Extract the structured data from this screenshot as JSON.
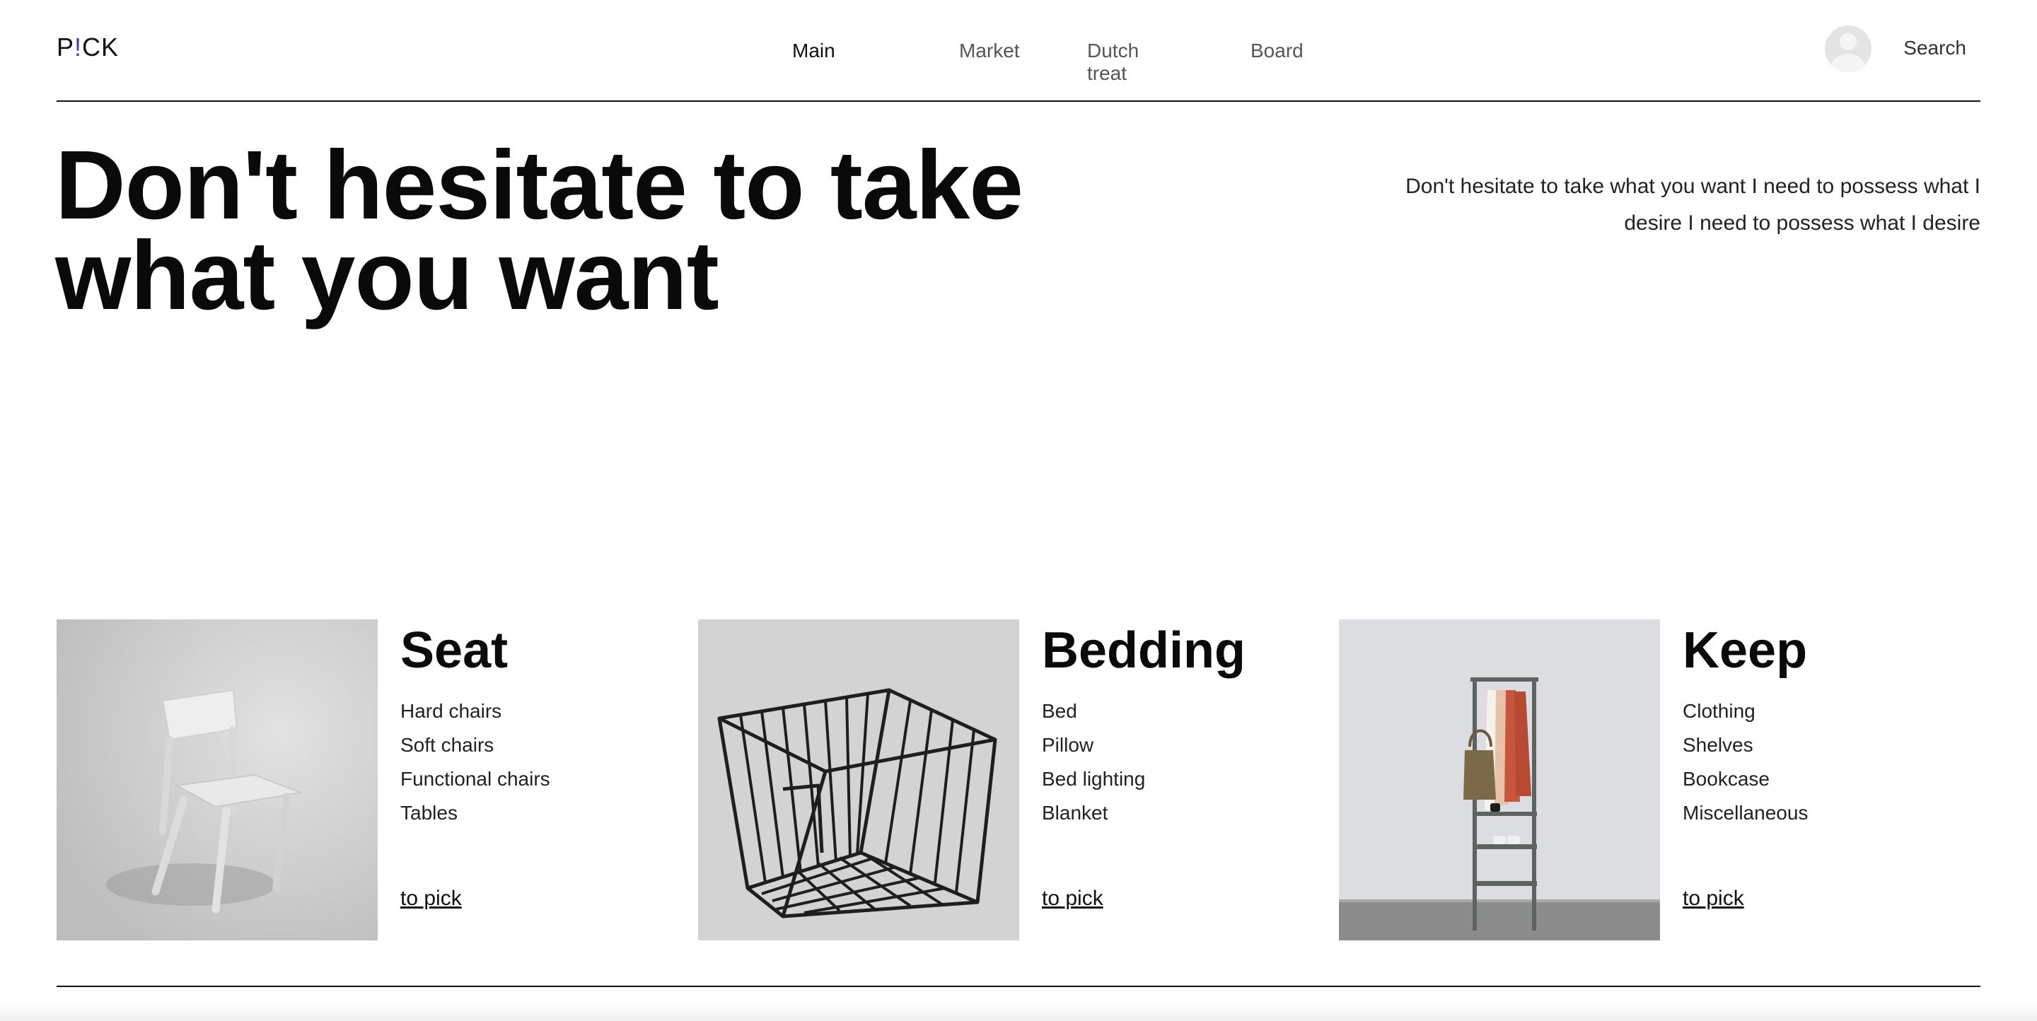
{
  "header": {
    "logo_left": "P",
    "logo_mark": "!",
    "logo_right": "CK",
    "nav": [
      {
        "label": "Main",
        "active": true
      },
      {
        "label": "Market",
        "active": false
      },
      {
        "label": "Dutch treat",
        "active": false
      },
      {
        "label": "Board",
        "active": false
      }
    ],
    "search_label": "Search"
  },
  "hero": {
    "title_line1": "Don't hesitate to take",
    "title_line2": "what you want",
    "description": "Don't hesitate to take what you want I need to possess what I desire I need to possess what I desire"
  },
  "categories": [
    {
      "title": "Seat",
      "items": [
        "Hard chairs",
        "Soft chairs",
        "Functional chairs",
        "Tables"
      ],
      "link": "to pick",
      "image": "white-chair-photo"
    },
    {
      "title": "Bedding",
      "items": [
        "Bed",
        "Pillow",
        "Bed lighting",
        "Blanket"
      ],
      "link": "to pick",
      "image": "wire-basket-photo"
    },
    {
      "title": "Keep",
      "items": [
        "Clothing",
        "Shelves",
        "Bookcase",
        "Miscellaneous"
      ],
      "link": "to pick",
      "image": "clothes-rack-photo"
    }
  ],
  "colors": {
    "accent": "#3b45b5",
    "text": "#111111",
    "muted": "#555555"
  }
}
